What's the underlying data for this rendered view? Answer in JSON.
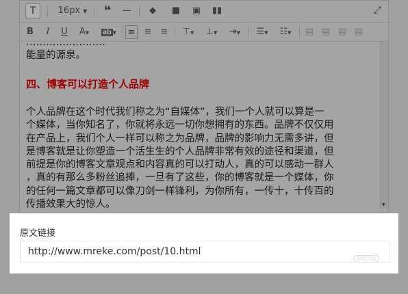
{
  "toolbar1": {
    "text_button": "T",
    "font_size": "16px",
    "quote_icon": "quote-icon",
    "hr_icon": "horizontal-rule-icon",
    "brush_icon": "format-brush-icon",
    "video_icon": "video-icon",
    "image_icon": "image-icon",
    "chart_icon": "chart-icon",
    "expand_icon": "expand-icon"
  },
  "toolbar2": {
    "bold": "B",
    "italic": "I",
    "underline": "U",
    "font_color": "A",
    "bg_color": "ab"
  },
  "content": {
    "intro_line_top": "……………………",
    "intro_line": "能量的源泉。",
    "heading": "四、博客可以打造个人品牌",
    "paragraph_lines": [
      "个人品牌在这个时代我们称之为“自媒体”，我们一个人就可以算是一",
      "个媒体，当你知名了，你就将永远一切你想拥有的东西。品牌不仅仅用",
      "在产品上，我们个人一样可以称之为品牌，品牌的影响力无需多讲，但",
      "是博客就是让你塑造一个活生生的个人品牌非常有效的途径和渠道，但",
      "前提是你的博客文章观点和内容真的可以打动人，真的可以感动一群人",
      "，真的有那么多粉丝追捧，一旦有了这些，你的博客就是一个媒体，你",
      "的任何一篇文章都可以像刀剑一样锋利，为你所有，一传十，十传百的",
      "传播效果大的惊人。"
    ]
  },
  "source_link": {
    "label": "原文链接",
    "value": "http://www.mreke.com/post/10.html"
  },
  "watermark": {
    "text": "微茶",
    "badge": "WXCHA"
  },
  "colors": {
    "overlay": "#a0a0a0",
    "heading": "#a00000",
    "card": "#ffffff"
  }
}
